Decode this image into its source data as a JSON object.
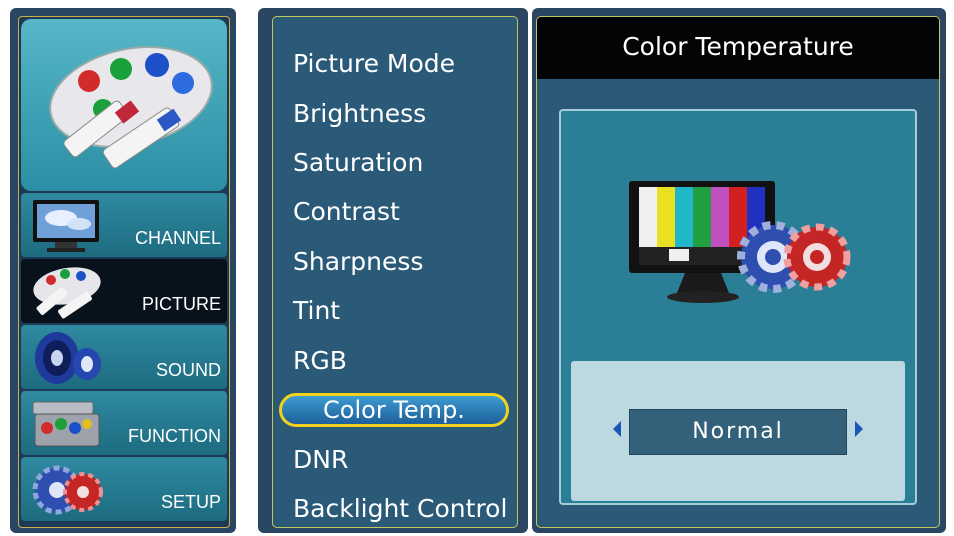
{
  "nav": {
    "items": [
      {
        "label": "CHANNEL",
        "icon": "tv-icon"
      },
      {
        "label": "PICTURE",
        "icon": "palette-icon",
        "active": true
      },
      {
        "label": "SOUND",
        "icon": "speaker-icon"
      },
      {
        "label": "FUNCTION",
        "icon": "toolbox-icon"
      },
      {
        "label": "SETUP",
        "icon": "gears-icon"
      }
    ]
  },
  "menu": {
    "items": [
      "Picture Mode",
      "Brightness",
      "Saturation",
      "Contrast",
      "Sharpness",
      "Tint",
      "RGB",
      "Color Temp.",
      "DNR",
      "Backlight Control"
    ],
    "selected": "Color Temp."
  },
  "detail": {
    "title": "Color Temperature",
    "value": "Normal",
    "icons": {
      "left": "arrow-left-icon",
      "right": "arrow-right-icon",
      "preview": "monitor-gears-icon"
    }
  },
  "colors": {
    "panel": "#2b4662",
    "menu_bg": "#2a5a78",
    "highlight_border": "#f2d21c",
    "arrow": "#1a56b4"
  }
}
